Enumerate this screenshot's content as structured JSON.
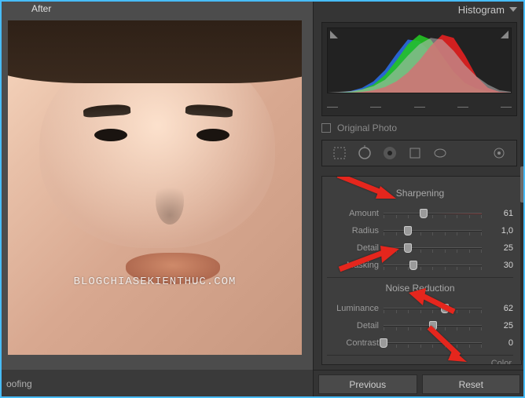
{
  "left": {
    "preview_tab": "After",
    "watermark": "BLOGCHIASEKIENTHUC.COM",
    "bottom_label": "oofing"
  },
  "right": {
    "panel_title": "Histogram",
    "original_photo_label": "Original Photo",
    "sections": {
      "sharpening": {
        "title": "Sharpening",
        "amount": {
          "label": "Amount",
          "value": "61",
          "pos": 41
        },
        "radius": {
          "label": "Radius",
          "value": "1,0",
          "pos": 25
        },
        "detail": {
          "label": "Detail",
          "value": "25",
          "pos": 25
        },
        "masking": {
          "label": "Masking",
          "value": "30",
          "pos": 30
        }
      },
      "noise": {
        "title": "Noise Reduction",
        "luminance": {
          "label": "Luminance",
          "value": "62",
          "pos": 62
        },
        "detail": {
          "label": "Detail",
          "value": "25",
          "pos": 50
        },
        "contrast": {
          "label": "Contrast",
          "value": "0",
          "pos": 0
        }
      },
      "color_title": "Color"
    },
    "buttons": {
      "previous": "Previous",
      "reset": "Reset"
    }
  },
  "chart_data": {
    "type": "area",
    "title": "Histogram",
    "xlabel": "",
    "ylabel": "",
    "x": [
      0,
      16,
      32,
      48,
      64,
      80,
      96,
      112,
      128,
      144,
      160,
      176,
      192,
      208,
      224,
      240,
      255
    ],
    "series": [
      {
        "name": "R",
        "color": "#e42020",
        "values": [
          0,
          0,
          0,
          2,
          4,
          8,
          14,
          22,
          34,
          50,
          70,
          88,
          80,
          52,
          22,
          6,
          0
        ]
      },
      {
        "name": "G",
        "color": "#24c424",
        "values": [
          0,
          0,
          2,
          5,
          10,
          18,
          30,
          48,
          70,
          86,
          78,
          54,
          30,
          14,
          6,
          2,
          0
        ]
      },
      {
        "name": "B",
        "color": "#2a6ae0",
        "values": [
          0,
          2,
          6,
          12,
          22,
          40,
          64,
          82,
          78,
          58,
          36,
          20,
          10,
          4,
          2,
          0,
          0
        ]
      },
      {
        "name": "L",
        "color": "#bcbcbc",
        "values": [
          0,
          1,
          3,
          6,
          11,
          20,
          34,
          52,
          70,
          82,
          80,
          66,
          46,
          28,
          14,
          5,
          1
        ]
      }
    ],
    "xlim": [
      0,
      255
    ],
    "ylim": [
      0,
      100
    ]
  }
}
